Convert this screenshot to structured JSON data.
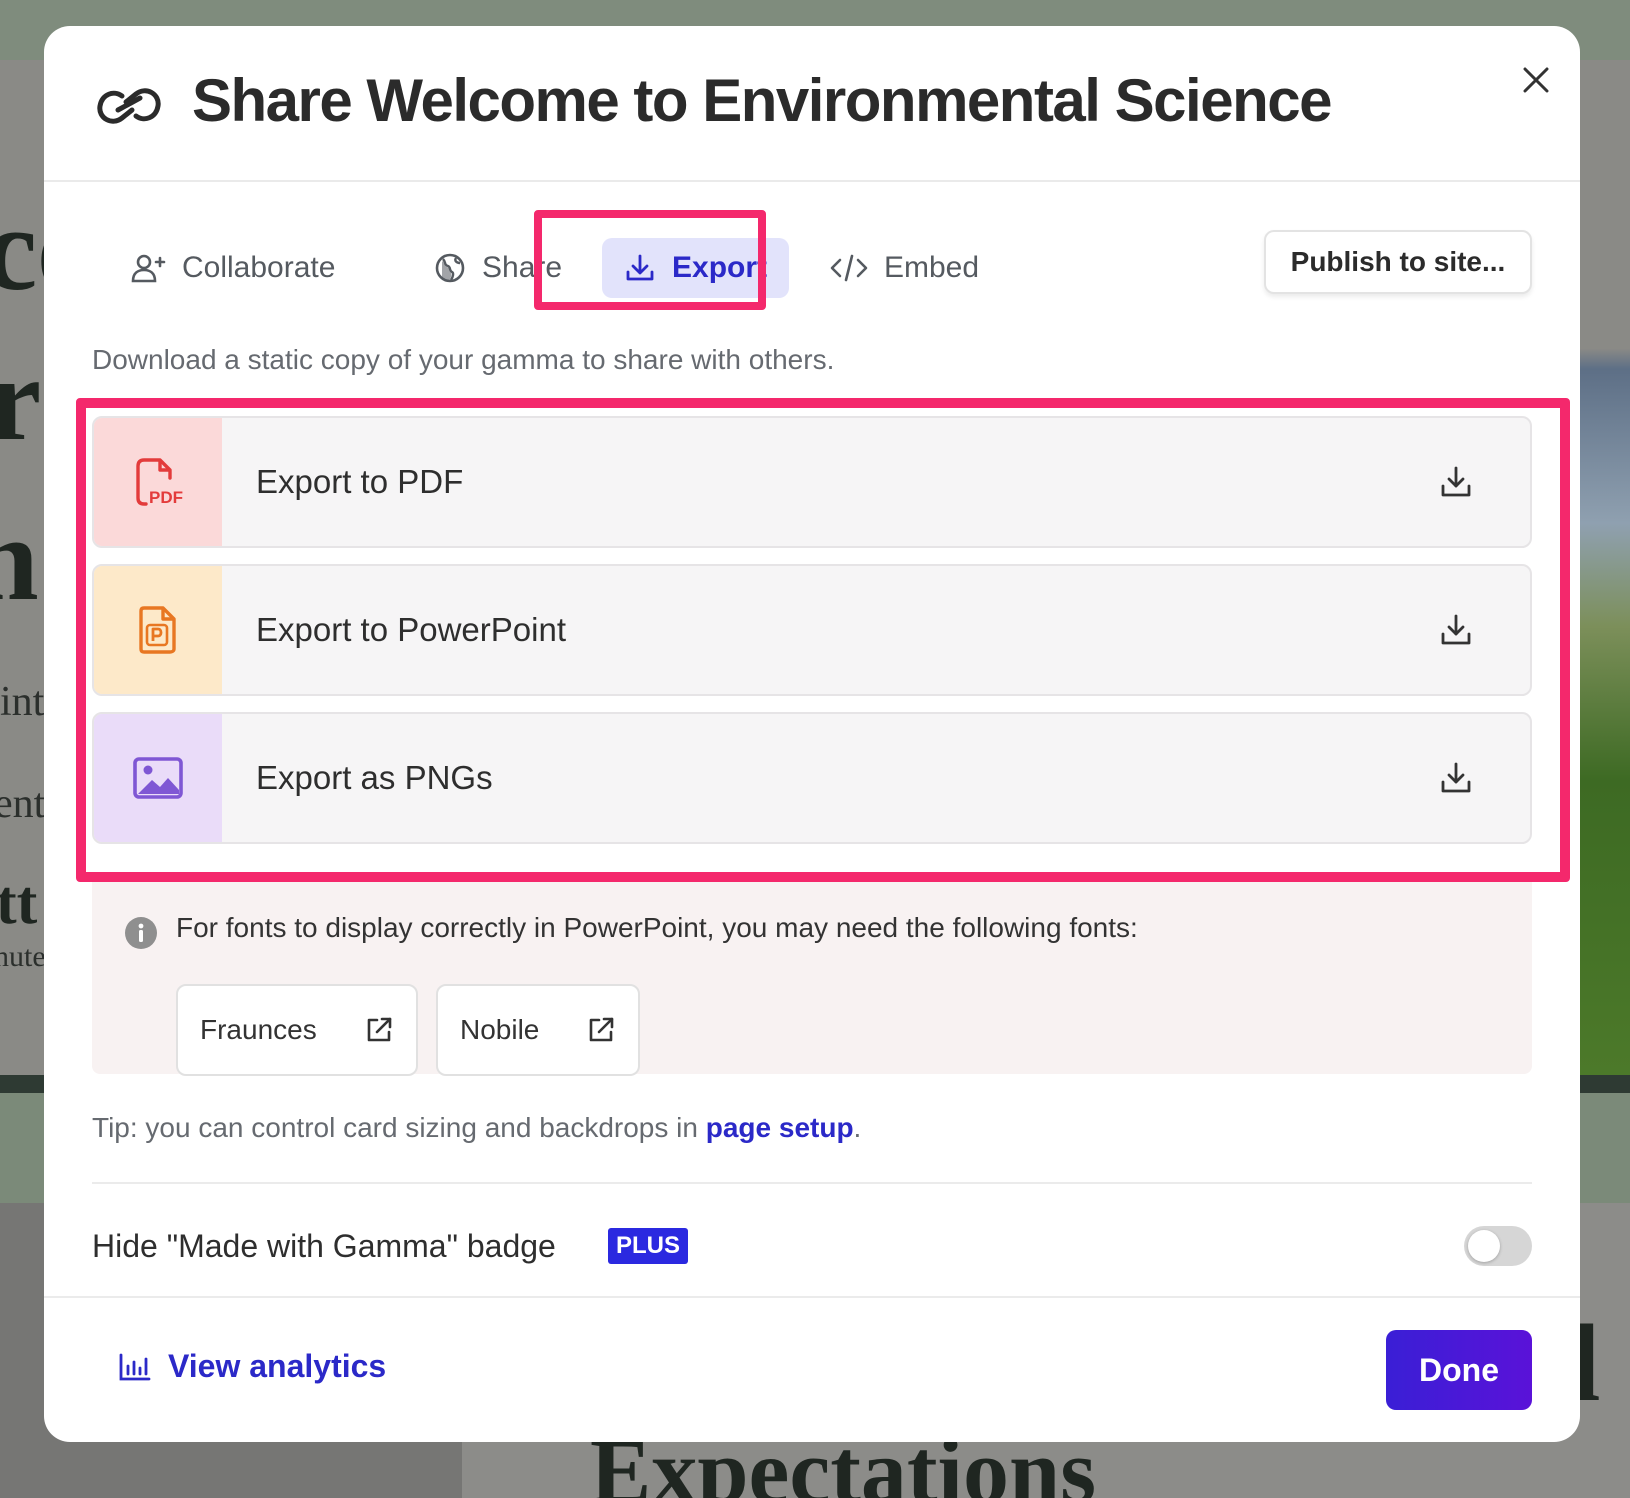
{
  "background": {
    "fragments": [
      "ce",
      "r",
      "n",
      "int",
      "ent",
      "tt",
      "nute",
      "Expectations",
      "l"
    ]
  },
  "modal": {
    "title": "Share Welcome to Environmental Science",
    "header_icon": "link-icon",
    "close_icon": "close-icon"
  },
  "tabs": [
    {
      "label": "Collaborate",
      "icon": "user-plus-icon",
      "active": false
    },
    {
      "label": "Share",
      "icon": "globe-icon",
      "active": false
    },
    {
      "label": "Export",
      "icon": "download-icon",
      "active": true
    },
    {
      "label": "Embed",
      "icon": "code-icon",
      "active": false
    }
  ],
  "publish_button": {
    "label": "Publish to site..."
  },
  "description": "Download a static copy of your gamma to share with others.",
  "export_options": [
    {
      "label": "Export to PDF",
      "icon": "pdf-file-icon",
      "color": "#e33b3b"
    },
    {
      "label": "Export to PowerPoint",
      "icon": "powerpoint-file-icon",
      "color": "#e87722"
    },
    {
      "label": "Export as PNGs",
      "icon": "image-icon",
      "color": "#7f57d4"
    }
  ],
  "fonts_notice": {
    "text": "For fonts to display correctly in PowerPoint, you may need the following fonts:",
    "fonts": [
      {
        "name": "Fraunces",
        "icon": "external-link-icon"
      },
      {
        "name": "Nobile",
        "icon": "external-link-icon"
      }
    ]
  },
  "tip": {
    "prefix": "Tip: you can control card sizing and backdrops in ",
    "link": "page setup",
    "suffix": "."
  },
  "badge_setting": {
    "label": "Hide \"Made with Gamma\" badge",
    "plan": "PLUS",
    "enabled": false
  },
  "footer": {
    "analytics_label": "View analytics",
    "analytics_icon": "bar-chart-icon",
    "done_label": "Done"
  },
  "colors": {
    "accent": "#2b29c8",
    "highlight": "#f4286c",
    "done_button": "#4318d6"
  }
}
